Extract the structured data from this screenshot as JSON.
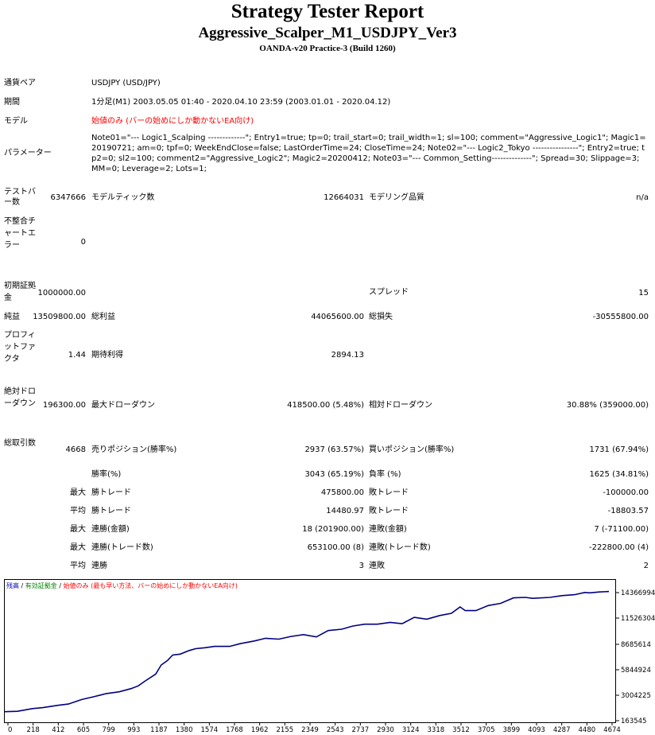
{
  "header": {
    "title": "Strategy Tester Report",
    "ea_name": "Aggressive_Scalper_M1_USDJPY_Ver3",
    "server": "OANDA-v20 Practice-3 (Build 1260)"
  },
  "info": {
    "pair_label": "通貨ペア",
    "pair_value": "USDJPY (USD/JPY)",
    "period_label": "期間",
    "period_value": "1分足(M1) 2003.05.05 01:40 - 2020.04.10 23:59 (2003.01.01 - 2020.04.12)",
    "model_label": "モデル",
    "model_value": "始値のみ (バーの始めにしか動かないEA向け)",
    "params_label": "パラメーター",
    "params_value": "Note01=\"--- Logic1_Scalping -------------\"; Entry1=true; tp=0; trail_start=0; trail_width=1; sl=100; comment=\"Aggressive_Logic1\"; Magic1=20190721; am=0; tpf=0; WeekEndClose=false; LastOrderTime=24; CloseTime=24; Note02=\"--- Logic2_Tokyo ----------------\"; Entry2=true; tp2=0; sl2=100; comment2=\"Aggressive_Logic2\"; Magic2=20200412; Note03=\"--- Common_Setting--------------\"; Spread=30; Slippage=3; MM=0; Leverage=2; Lots=1;"
  },
  "stats": {
    "bars_label": "テストバー数",
    "bars_value": "6347666",
    "ticks_label": "モデルティック数",
    "ticks_value": "12664031",
    "quality_label": "モデリング品質",
    "quality_value": "n/a",
    "mismatch_label": "不整合チャートエラー",
    "mismatch_value": "0",
    "deposit_label": "初期証拠金",
    "deposit_value": "1000000.00",
    "spread_label": "スプレッド",
    "spread_value": "15",
    "net_label": "純益",
    "net_value": "13509800.00",
    "gross_profit_label": "総利益",
    "gross_profit_value": "44065600.00",
    "gross_loss_label": "総損失",
    "gross_loss_value": "-30555800.00",
    "pf_label": "プロフィットファクタ",
    "pf_value": "1.44",
    "expected_label": "期待利得",
    "expected_value": "2894.13",
    "abs_dd_label": "絶対ドローダウン",
    "abs_dd_value": "196300.00",
    "max_dd_label": "最大ドローダウン",
    "max_dd_value": "418500.00 (5.48%)",
    "rel_dd_label": "相対ドローダウン",
    "rel_dd_value": "30.88% (359000.00)",
    "total_trades_label": "総取引数",
    "total_trades_value": "4668",
    "short_label": "売りポジション(勝率%)",
    "short_value": "2937 (63.57%)",
    "long_label": "買いポジション(勝率%)",
    "long_value": "1731 (67.94%)",
    "winrate_label": "勝率(%)",
    "winrate_value": "3043 (65.19%)",
    "lossrate_label": "負率 (%)",
    "lossrate_value": "1625 (34.81%)",
    "max_label": "最大",
    "avg_label": "平均",
    "largest_win_label": "勝トレード",
    "largest_win_value": "475800.00",
    "largest_loss_label": "敗トレード",
    "largest_loss_value": "-100000.00",
    "avg_win_label": "勝トレード",
    "avg_win_value": "14480.97",
    "avg_loss_label": "敗トレード",
    "avg_loss_value": "-18803.57",
    "max_consec_wins_label": "連勝(金額)",
    "max_consec_wins_value": "18 (201900.00)",
    "max_consec_losses_label": "連敗(金額)",
    "max_consec_losses_value": "7 (-71100.00)",
    "max_consec_profit_label": "連勝(トレード数)",
    "max_consec_profit_value": "653100.00 (8)",
    "max_consec_loss_label": "連敗(トレード数)",
    "max_consec_loss_value": "-222800.00 (4)",
    "avg_consec_wins_label": "連勝",
    "avg_consec_wins_value": "3",
    "avg_consec_losses_label": "連敗",
    "avg_consec_losses_value": "2"
  },
  "chart_legend": {
    "balance": "残高",
    "sep1": " / ",
    "equity": "有効証拠金",
    "sep2": " / ",
    "model": "始値のみ (最も早い方法、バーの始めにしか動かないEA向け)",
    "balance_color": "#0000aa",
    "equity_color": "#008000",
    "model_color": "#ff0000"
  },
  "chart_data": {
    "type": "line",
    "title": "",
    "xlabel": "",
    "ylabel": "",
    "x_ticks": [
      "0",
      "218",
      "412",
      "605",
      "799",
      "993",
      "1187",
      "1380",
      "1574",
      "1768",
      "1962",
      "2155",
      "2349",
      "2543",
      "2737",
      "2930",
      "3124",
      "3318",
      "3512",
      "3705",
      "3899",
      "4093",
      "4287",
      "4480",
      "4674"
    ],
    "y_ticks": [
      "14366994",
      "11526304",
      "8685614",
      "5844924",
      "3004225",
      "163545"
    ],
    "xlim": [
      0,
      4800
    ],
    "ylim": [
      163545,
      14366994
    ],
    "grid": false,
    "line_color": "#000080",
    "series": [
      {
        "x": [
          0,
          100,
          218,
          300,
          412,
          500,
          605,
          700,
          799,
          900,
          993,
          1050,
          1100,
          1187,
          1230,
          1280,
          1320,
          1380,
          1450,
          1500,
          1574,
          1650,
          1768,
          1850,
          1962,
          2050,
          2155,
          2250,
          2349,
          2450,
          2543,
          2650,
          2737,
          2830,
          2930,
          3030,
          3124,
          3220,
          3318,
          3420,
          3512,
          3580,
          3620,
          3705,
          3800,
          3899,
          3950,
          4000,
          4093,
          4150,
          4287,
          4380,
          4480,
          4560,
          4600,
          4674,
          4750
        ],
        "y": [
          1150000,
          1200000,
          1500000,
          1600000,
          1850000,
          2000000,
          2500000,
          2800000,
          3150000,
          3350000,
          3700000,
          4000000,
          4500000,
          5300000,
          6300000,
          6800000,
          7400000,
          7500000,
          7900000,
          8100000,
          8200000,
          8350000,
          8350000,
          8650000,
          8950000,
          9250000,
          9150000,
          9450000,
          9650000,
          9400000,
          10100000,
          10250000,
          10600000,
          10800000,
          10800000,
          11000000,
          10850000,
          11550000,
          11350000,
          11750000,
          12000000,
          12700000,
          12300000,
          12300000,
          12850000,
          13100000,
          13400000,
          13700000,
          13750000,
          13650000,
          13750000,
          13950000,
          14050000,
          14300000,
          14250000,
          14350000,
          14400000
        ]
      }
    ]
  }
}
